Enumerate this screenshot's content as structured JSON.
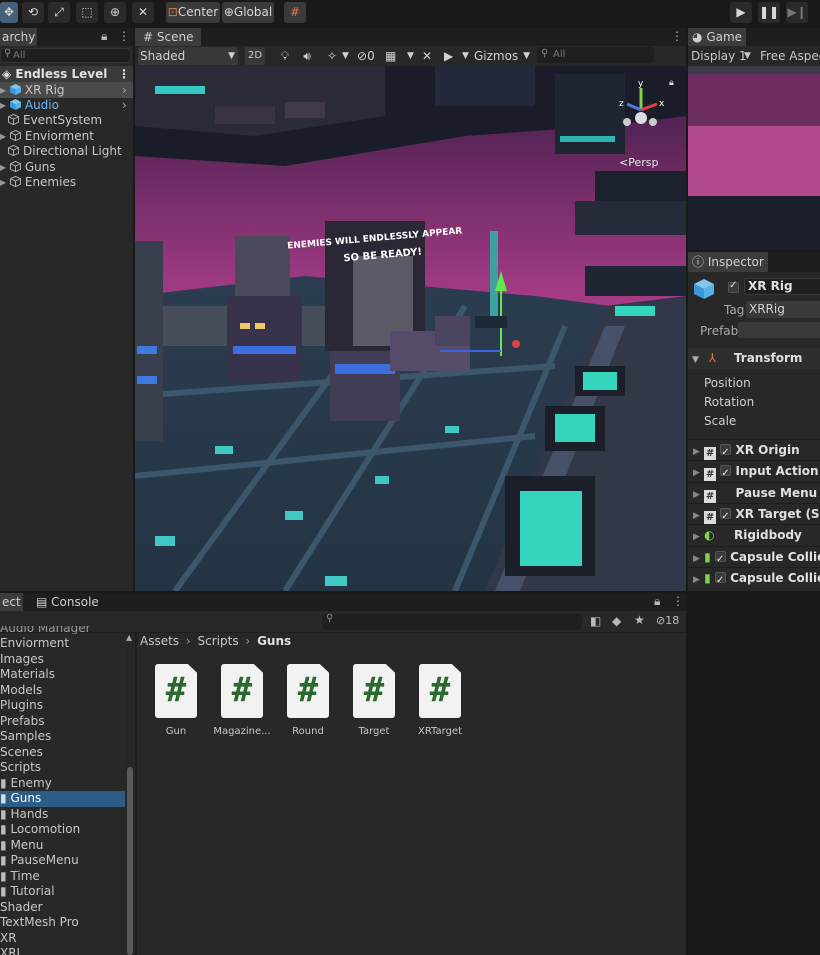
{
  "toolbar": {
    "pivot_label": "Center",
    "space_label": "Global"
  },
  "hierarchy": {
    "tab_label": "archy",
    "search_placeholder": "All",
    "scene_name": "Endless Level",
    "items": [
      {
        "label": "XR Rig"
      },
      {
        "label": "Audio"
      },
      {
        "label": "EventSystem"
      },
      {
        "label": "Enviorment"
      },
      {
        "label": "Directional Light"
      },
      {
        "label": "Guns"
      },
      {
        "label": "Enemies"
      }
    ]
  },
  "scene": {
    "tab_label": "Scene",
    "shading_mode": "Shaded",
    "mode_2d": "2D",
    "hidden_count": "0",
    "gizmos_label": "Gizmos",
    "search_placeholder": "All",
    "persp_label": "Persp",
    "billboard_line1": "ENEMIES WILL ENDLESSLY APPEAR",
    "billboard_line2": "SO BE READY!"
  },
  "game": {
    "tab_label": "Game",
    "display_label": "Display 1",
    "aspect_label": "Free Aspect"
  },
  "inspector": {
    "tab_label": "Inspector",
    "object_name": "XR Rig",
    "tag_label": "Tag",
    "tag_value": "XRRig",
    "prefab_label": "Prefab",
    "transform_label": "Transform",
    "position_label": "Position",
    "rotation_label": "Rotation",
    "scale_label": "Scale",
    "components": [
      {
        "label": "XR Origin"
      },
      {
        "label": "Input Action Ma"
      },
      {
        "label": "Pause Menu (Sc"
      },
      {
        "label": "XR Target (Scrip"
      },
      {
        "label": "Rigidbody"
      },
      {
        "label": "Capsule Collider"
      },
      {
        "label": "Capsule Collider"
      }
    ]
  },
  "project": {
    "tab_label": "ect",
    "console_label": "Console",
    "hidden_count": "18",
    "breadcrumb": [
      "Assets",
      "Scripts",
      "Guns"
    ],
    "folders_top_cut": "Audio Manager",
    "folders": [
      {
        "label": "Enviorment"
      },
      {
        "label": "Images"
      },
      {
        "label": "Materials"
      },
      {
        "label": "Models"
      },
      {
        "label": "Plugins"
      },
      {
        "label": "Prefabs"
      },
      {
        "label": "Samples"
      },
      {
        "label": "Scenes"
      },
      {
        "label": "Scripts"
      },
      {
        "label": "Enemy"
      },
      {
        "label": "Guns"
      },
      {
        "label": "Hands"
      },
      {
        "label": "Locomotion"
      },
      {
        "label": "Menu"
      },
      {
        "label": "PauseMenu"
      },
      {
        "label": "Time"
      },
      {
        "label": "Tutorial"
      },
      {
        "label": "Shader"
      },
      {
        "label": "TextMesh Pro"
      },
      {
        "label": "XR"
      },
      {
        "label": "XRI"
      }
    ],
    "assets": [
      {
        "label": "Gun"
      },
      {
        "label": "Magazine..."
      },
      {
        "label": "Round"
      },
      {
        "label": "Target"
      },
      {
        "label": "XRTarget"
      }
    ],
    "script_glyph": "#"
  },
  "colors": {
    "accent_blue": "#2c5d87",
    "sky_magenta": "#b0408a",
    "neon_cyan": "#3ee6c8"
  }
}
